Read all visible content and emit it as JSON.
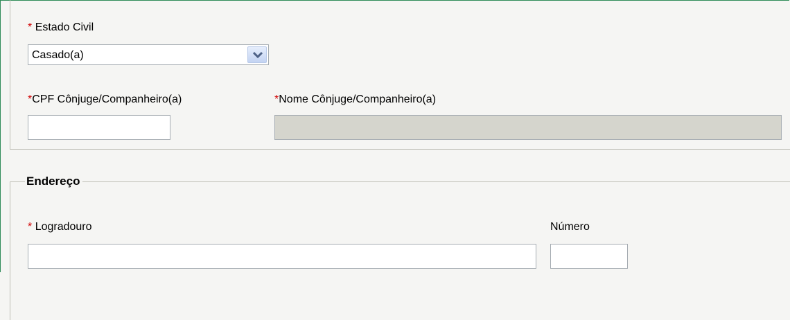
{
  "marital_status": {
    "required_marker": "*",
    "label": "Estado Civil",
    "selected_value": "Casado(a)",
    "dropdown_icon": "chevron-down-icon"
  },
  "spouse": {
    "cpf_required_marker": "*",
    "cpf_label": "CPF Cônjuge/Companheiro(a)",
    "cpf_value": "",
    "name_required_marker": "*",
    "name_label": "Nome Cônjuge/Companheiro(a)",
    "name_value": ""
  },
  "address": {
    "legend": "Endereço",
    "street_required_marker": "*",
    "street_label": "Logradouro",
    "street_value": "",
    "number_label": "Número",
    "number_value": ""
  },
  "colors": {
    "required": "#d00000",
    "disabled_field": "#d5d5cd",
    "frame_border": "#2e8b57"
  }
}
